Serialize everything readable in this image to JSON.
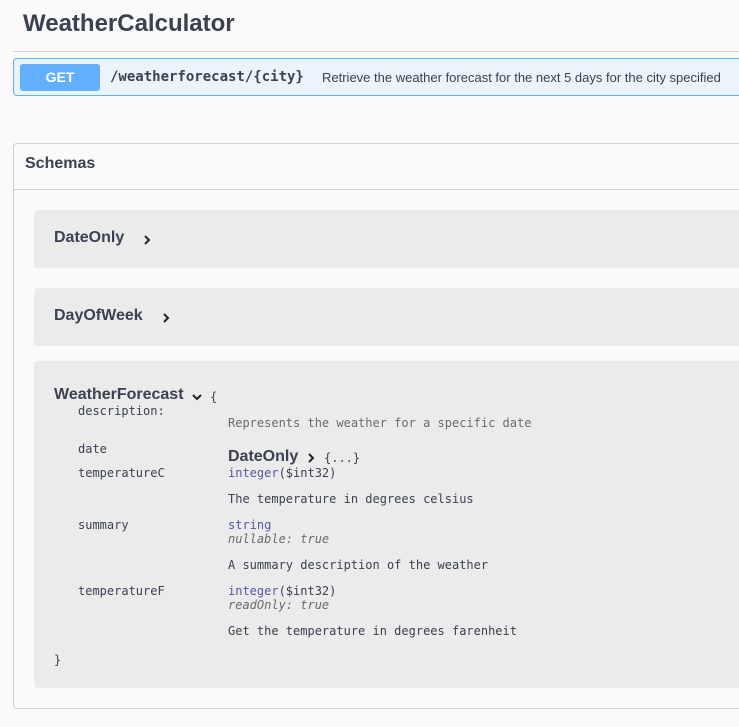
{
  "app": {
    "title": "WeatherCalculator"
  },
  "operation": {
    "method": "GET",
    "path": "/weatherforecast/{city}",
    "summary": "Retrieve the weather forecast for the next 5 days for the city specified"
  },
  "schemas": {
    "title": "Schemas",
    "models": [
      {
        "name": "DateOnly"
      },
      {
        "name": "DayOfWeek"
      },
      {
        "name": "WeatherForecast",
        "open_brace": "{",
        "close_brace": "}",
        "description_label": "description:",
        "description": "Represents the weather for a specific date",
        "properties": [
          {
            "name": "date",
            "ref": "DateOnly",
            "ref_collapsed": "{...}"
          },
          {
            "name": "temperatureC",
            "type": "integer",
            "format": "($int32)",
            "description": "The temperature in degrees celsius"
          },
          {
            "name": "summary",
            "type": "string",
            "extra": "nullable: true",
            "description": "A summary description of the weather"
          },
          {
            "name": "temperatureF",
            "type": "integer",
            "format": "($int32)",
            "extra": "readOnly: true",
            "description": "Get the temperature in degrees farenheit"
          }
        ]
      }
    ]
  }
}
